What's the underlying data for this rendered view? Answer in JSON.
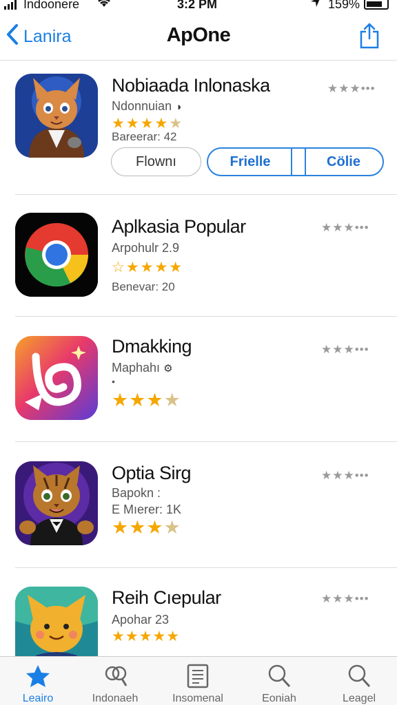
{
  "status": {
    "carrier": "Indoonere",
    "time": "3:2 PM",
    "battery": "159%"
  },
  "nav": {
    "back_label": "Lanira",
    "title": "ApOne"
  },
  "apps": [
    {
      "name": "Nobiaada Inlonaska",
      "developer": "Ndonnuian",
      "rating_count": "Bareerar: 42",
      "stars": "★★★★",
      "stars_dim": "★"
    },
    {
      "name": "Aplkasia Popular",
      "developer": "Arpohulr 2.9",
      "rating_count": "Benevar: 20",
      "stars": "☆★★★★",
      "stars_dim": ""
    },
    {
      "name": "Dmakking",
      "developer": "Maphahı",
      "rating_count": "",
      "stars": "★★★",
      "stars_dim": "★"
    },
    {
      "name": "Optia Sirg",
      "developer": "Ваpokn :",
      "rating_count": "E Mıerer: 1K",
      "stars": "★★★",
      "stars_dim": "★"
    },
    {
      "name": "Reih Cıepular",
      "developer": "Apohar 23",
      "rating_count": "",
      "stars": "★★★★★",
      "stars_dim": ""
    }
  ],
  "rating_dots": "★★★•••",
  "buttons": {
    "flown": "Flownı",
    "frielle": "Frielle",
    "colie": "Cölie"
  },
  "tabs": [
    {
      "label": "Leairo",
      "icon": "star-icon",
      "active": true
    },
    {
      "label": "Indonaeh",
      "icon": "people-icon",
      "active": false
    },
    {
      "label": "Insomenal",
      "icon": "list-icon",
      "active": false
    },
    {
      "label": "Eoniah",
      "icon": "search-icon",
      "active": false
    },
    {
      "label": "Leagel",
      "icon": "search-icon",
      "active": false
    }
  ],
  "colors": {
    "accent": "#1a7fe5",
    "star": "#f5a700"
  }
}
